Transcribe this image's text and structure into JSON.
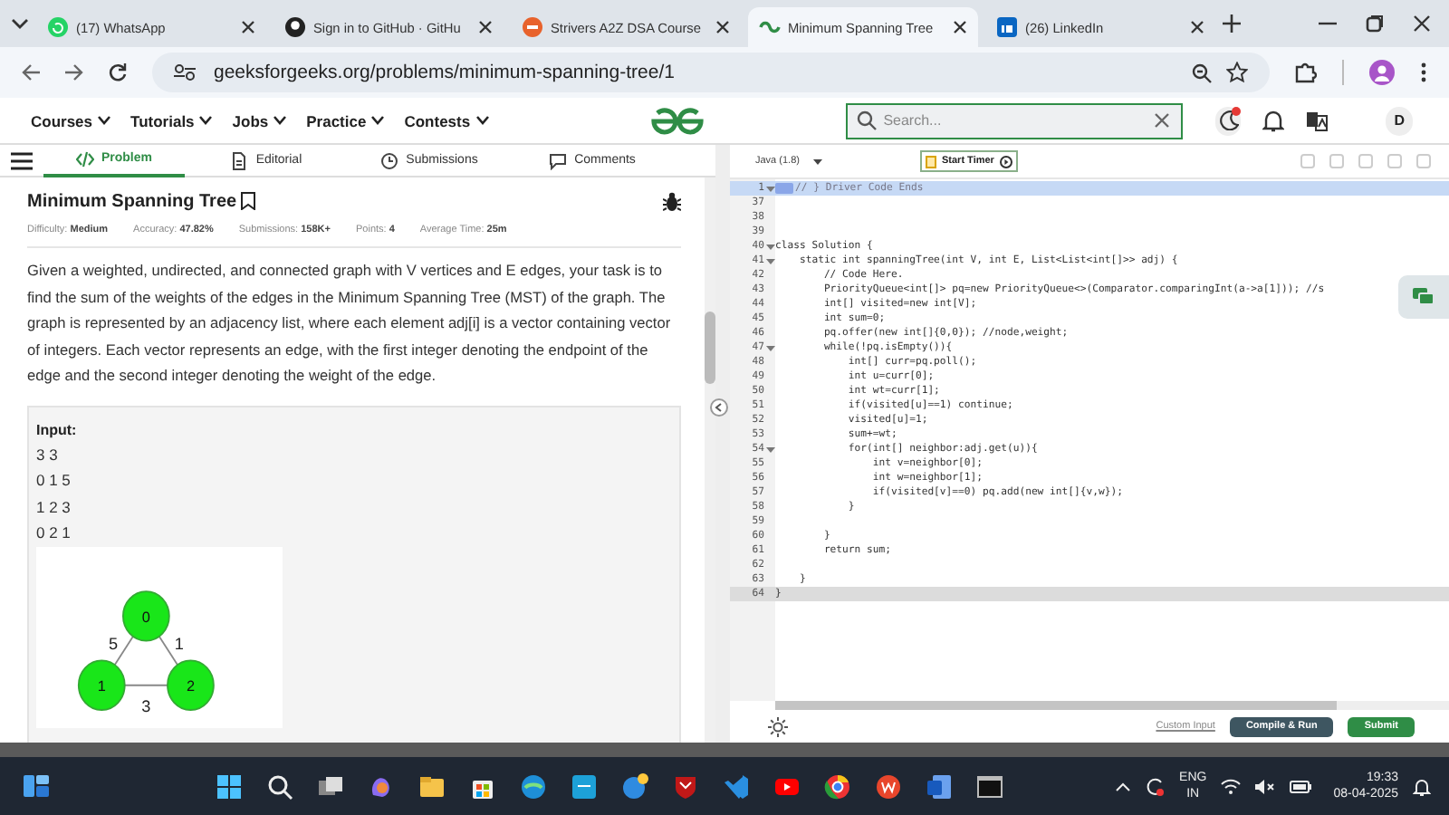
{
  "browser_tabs": [
    {
      "title": "(17) WhatsApp",
      "selected": false
    },
    {
      "title": "Sign in to GitHub · GitHu",
      "selected": false
    },
    {
      "title": "Strivers A2Z DSA Course",
      "selected": false
    },
    {
      "title": "Minimum Spanning Tree",
      "selected": true
    },
    {
      "title": "(26) LinkedIn",
      "selected": false
    }
  ],
  "address_bar": {
    "url": "geeksforgeeks.org/problems/minimum-spanning-tree/1"
  },
  "site_nav": {
    "menus": [
      "Courses",
      "Tutorials",
      "Jobs",
      "Practice",
      "Contests"
    ],
    "search": {
      "placeholder": "Search..."
    },
    "avatar": "D"
  },
  "problem_tabs": [
    {
      "label": "Problem",
      "selected": true
    },
    {
      "label": "Editorial",
      "selected": false
    },
    {
      "label": "Submissions",
      "selected": false
    },
    {
      "label": "Comments",
      "selected": false
    }
  ],
  "problem": {
    "title": "Minimum Spanning Tree",
    "meta": [
      "Difficulty: **Medium**",
      "Accuracy: **47.82%**",
      "Submissions: **158K+**",
      "Points: **4**",
      "Average Time: **25m**"
    ],
    "description": "Given a weighted, undirected, and connected graph with V vertices and E edges, your task is to find the sum of the weights of the edges in the Minimum Spanning Tree (MST) of the graph. The graph is represented by an adjacency list, where each element adj[i] is a vector containing vector of integers. Each vector represents an edge, with the first integer denoting the endpoint of the edge and the second integer denoting the weight of the edge.",
    "example": {
      "heading": "Input:",
      "lines": [
        "3 3",
        "0 1 5",
        "1 2 3",
        "0 2 1"
      ],
      "graph": {
        "nodes": [
          "0",
          "1",
          "2"
        ],
        "edges": [
          {
            "weight": "5"
          },
          {
            "weight": "1"
          },
          {
            "weight": "3"
          }
        ]
      }
    }
  },
  "editor": {
    "language": "Java (1.8)",
    "timer_button": "Start Timer",
    "lines": [
      {
        "n": "1",
        "code": "// } Driver Code Ends",
        "foldable": true,
        "selected": true,
        "current": false
      },
      {
        "n": "37",
        "foldable": false,
        "selected": false,
        "current": false
      },
      {
        "n": "38",
        "foldable": false,
        "selected": false,
        "current": false
      },
      {
        "n": "39",
        "foldable": false,
        "selected": false,
        "current": false
      },
      {
        "n": "40",
        "code": "class Solution {",
        "foldable": true,
        "selected": false,
        "current": false
      },
      {
        "n": "41",
        "code": "    static int spanningTree(int V, int E, List<List<int[]>> adj) {",
        "foldable": true,
        "selected": false,
        "current": false
      },
      {
        "n": "42",
        "code": "        // Code Here.",
        "foldable": false,
        "selected": false,
        "current": false
      },
      {
        "n": "43",
        "code": "        PriorityQueue<int[]> pq=new PriorityQueue<>(Comparator.comparingInt(a->a[1])); //s",
        "foldable": false,
        "selected": false,
        "current": false
      },
      {
        "n": "44",
        "code": "        int[] visited=new int[V];",
        "foldable": false,
        "selected": false,
        "current": false
      },
      {
        "n": "45",
        "code": "        int sum=0;",
        "foldable": false,
        "selected": false,
        "current": false
      },
      {
        "n": "46",
        "code": "        pq.offer(new int[]{0,0}); //node,weight;",
        "foldable": false,
        "selected": false,
        "current": false
      },
      {
        "n": "47",
        "code": "        while(!pq.isEmpty()){",
        "foldable": true,
        "selected": false,
        "current": false
      },
      {
        "n": "48",
        "code": "            int[] curr=pq.poll();",
        "foldable": false,
        "selected": false,
        "current": false
      },
      {
        "n": "49",
        "code": "            int u=curr[0];",
        "foldable": false,
        "selected": false,
        "current": false
      },
      {
        "n": "50",
        "code": "            int wt=curr[1];",
        "foldable": false,
        "selected": false,
        "current": false
      },
      {
        "n": "51",
        "code": "            if(visited[u]==1) continue;",
        "foldable": false,
        "selected": false,
        "current": false
      },
      {
        "n": "52",
        "code": "            visited[u]=1;",
        "foldable": false,
        "selected": false,
        "current": false
      },
      {
        "n": "53",
        "code": "            sum+=wt;",
        "foldable": false,
        "selected": false,
        "current": false
      },
      {
        "n": "54",
        "code": "            for(int[] neighbor:adj.get(u)){",
        "foldable": true,
        "selected": false,
        "current": false
      },
      {
        "n": "55",
        "code": "                int v=neighbor[0];",
        "foldable": false,
        "selected": false,
        "current": false
      },
      {
        "n": "56",
        "code": "                int w=neighbor[1];",
        "foldable": false,
        "selected": false,
        "current": false
      },
      {
        "n": "57",
        "code": "                if(visited[v]==0) pq.add(new int[]{v,w});",
        "foldable": false,
        "selected": false,
        "current": false
      },
      {
        "n": "58",
        "code": "            }",
        "foldable": false,
        "selected": false,
        "current": false
      },
      {
        "n": "59",
        "foldable": false,
        "selected": false,
        "current": false
      },
      {
        "n": "60",
        "code": "        }",
        "foldable": false,
        "selected": false,
        "current": false
      },
      {
        "n": "61",
        "code": "        return sum;",
        "foldable": false,
        "selected": false,
        "current": false
      },
      {
        "n": "62",
        "foldable": false,
        "selected": false,
        "current": false
      },
      {
        "n": "63",
        "code": "    }",
        "foldable": false,
        "selected": false,
        "current": false
      },
      {
        "n": "64",
        "code": "}",
        "foldable": false,
        "selected": false,
        "current": true
      }
    ],
    "custom_input": "Custom Input",
    "run_button": "Compile & Run",
    "submit_button": "Submit"
  },
  "taskbar": {
    "language": "ENG",
    "region": "IN",
    "time": "19:33",
    "date": "08-04-2025"
  }
}
